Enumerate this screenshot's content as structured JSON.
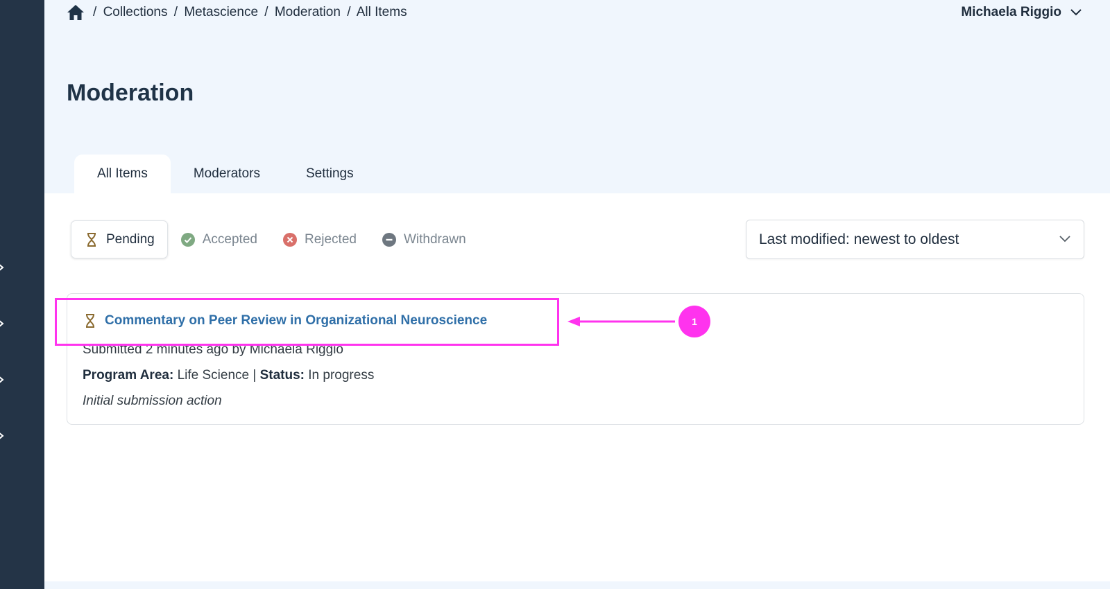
{
  "breadcrumb": {
    "separator": "/",
    "items": [
      "Collections",
      "Metascience",
      "Moderation",
      "All Items"
    ]
  },
  "user": {
    "name": "Michaela Riggio"
  },
  "page": {
    "title": "Moderation"
  },
  "tabs": [
    {
      "label": "All Items",
      "active": true
    },
    {
      "label": "Moderators",
      "active": false
    },
    {
      "label": "Settings",
      "active": false
    }
  ],
  "filters": [
    {
      "label": "Pending",
      "icon": "hourglass-icon",
      "active": true
    },
    {
      "label": "Accepted",
      "icon": "check-circle-icon",
      "color": "#7fa982"
    },
    {
      "label": "Rejected",
      "icon": "x-circle-icon",
      "color": "#d9706a"
    },
    {
      "label": "Withdrawn",
      "icon": "minus-circle-icon",
      "color": "#6e7780"
    }
  ],
  "sort": {
    "selected": "Last modified: newest to oldest"
  },
  "item": {
    "title": "Commentary on Peer Review in Organizational Neuroscience",
    "meta": "Submitted 2 minutes ago by Michaela Riggio",
    "program_area_label": "Program Area:",
    "program_area_value": "Life Science",
    "divider": "|",
    "status_label": "Status:",
    "status_value": "In progress",
    "note": "Initial submission action"
  },
  "annotation": {
    "badge": "1",
    "color": "#ff33ee"
  },
  "colors": {
    "sidebar": "#243447",
    "background": "#f0f6fd",
    "link": "#2f6fa8",
    "pending_icon": "#8a6a2f"
  }
}
